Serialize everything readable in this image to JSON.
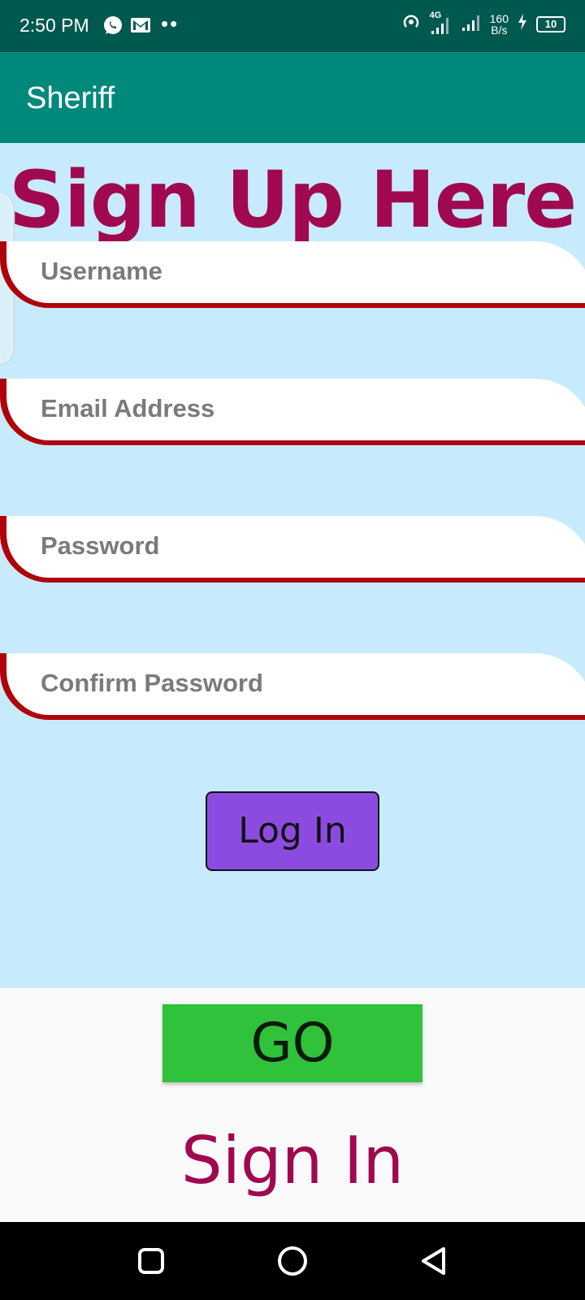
{
  "status_bar": {
    "time": "2:50 PM",
    "notifications": [
      "whatsapp-icon",
      "gmail-icon"
    ],
    "more_dots": "••",
    "network": "4G",
    "speed_value": "160",
    "speed_unit": "B/s",
    "battery": "10"
  },
  "app_bar": {
    "title": "Sheriff"
  },
  "form": {
    "heading": "Sign Up Here",
    "username_placeholder": "Username",
    "email_placeholder": "Email Address",
    "password_placeholder": "Password",
    "confirm_password_placeholder": "Confirm Password",
    "login_label": "Log In"
  },
  "footer": {
    "go_label": "GO",
    "sign_in_label": "Sign In"
  },
  "colors": {
    "status_bar": "#00594e",
    "app_bar": "#00897b",
    "content_bg": "#c7ebfc",
    "heading": "#a0084f",
    "field_border": "#b0000a",
    "login_button": "#8c4be0",
    "go_button": "#2fc23a"
  },
  "nav_bar": {
    "icons": [
      "recent-apps-icon",
      "home-icon",
      "back-icon"
    ]
  }
}
